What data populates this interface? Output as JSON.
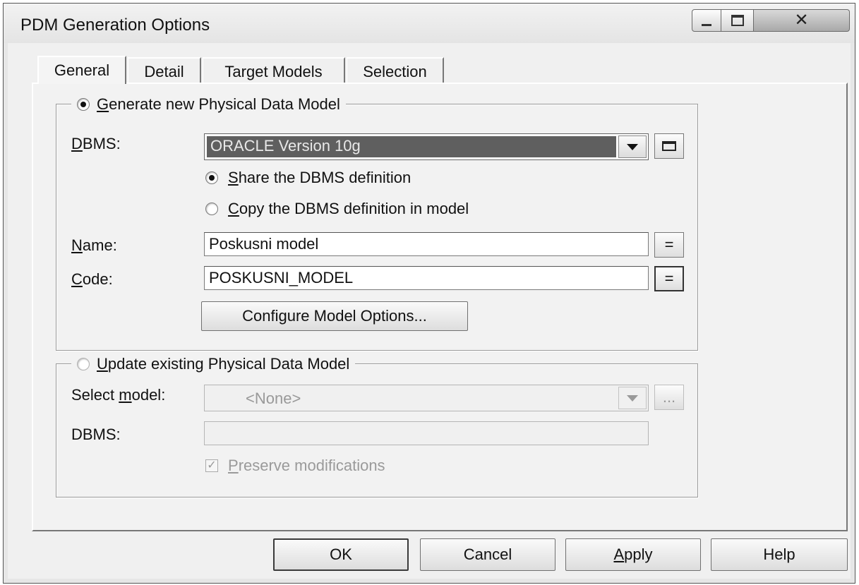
{
  "window": {
    "title": "PDM Generation Options",
    "controls": {
      "minimize_icon": "minimize-icon",
      "maximize_icon": "maximize-icon",
      "close_icon": "close-icon",
      "close_glyph": "✕"
    }
  },
  "tabs": [
    {
      "label": "General",
      "active": true
    },
    {
      "label": "Detail",
      "active": false
    },
    {
      "label": "Target Models",
      "active": false
    },
    {
      "label": "Selection",
      "active": false
    }
  ],
  "generate_group": {
    "radio_label_first": "G",
    "radio_label_rest": "enerate new Physical Data Model",
    "selected": true,
    "dbms_label_first": "D",
    "dbms_label_rest": "BMS:",
    "dbms_value": "ORACLE Version 10g",
    "share_first": "S",
    "share_rest": "hare the DBMS definition",
    "share_selected": true,
    "copy_first": "C",
    "copy_rest": "opy the DBMS definition in model",
    "copy_selected": false,
    "name_label_first": "N",
    "name_label_rest": "ame:",
    "name_value": "Poskusni model",
    "name_eq": "=",
    "code_label_first": "C",
    "code_label_rest": "ode:",
    "code_value": "POSKUSNI_MODEL",
    "code_eq": "=",
    "configure_button": "Configure Model Options..."
  },
  "update_group": {
    "radio_label_first": "U",
    "radio_label_rest": "pdate existing Physical Data Model",
    "selected": false,
    "select_model_label_a": "Select ",
    "select_model_label_u": "m",
    "select_model_label_b": "odel:",
    "select_model_value": "<None>",
    "browse_label": "...",
    "dbms_label": "DBMS:",
    "dbms_value": "",
    "preserve_check": "✓",
    "preserve_first": "P",
    "preserve_rest": "reserve modifications",
    "preserve_checked": true
  },
  "footer": {
    "ok": "OK",
    "cancel": "Cancel",
    "apply_first": "A",
    "apply_rest": "pply",
    "help": "Help"
  }
}
